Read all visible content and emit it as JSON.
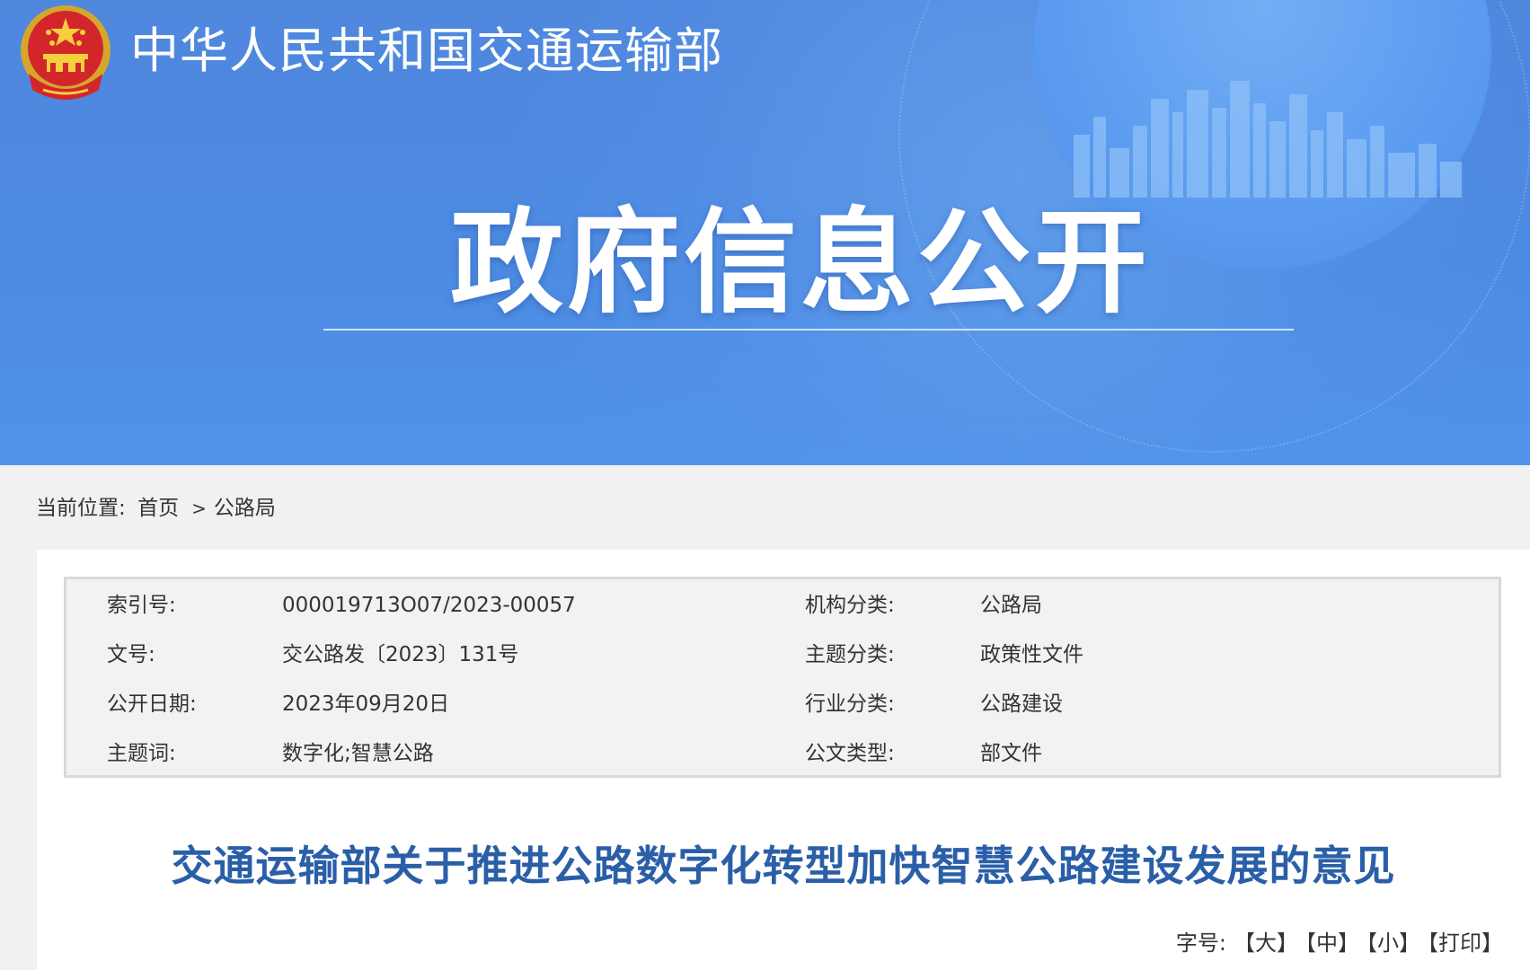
{
  "header": {
    "ministry_name": "中华人民共和国交通运输部",
    "section_title": "政府信息公开",
    "emblem_icon": "national-emblem-icon"
  },
  "breadcrumb": {
    "label": "当前位置:",
    "items": [
      "首页",
      "公路局"
    ],
    "separator": ">"
  },
  "meta": {
    "rows": [
      {
        "label1": "索引号:",
        "value1": "000019713O07/2023-00057",
        "label2": "机构分类:",
        "value2": "公路局"
      },
      {
        "label1": "文号:",
        "value1": "交公路发〔2023〕131号",
        "label2": "主题分类:",
        "value2": "政策性文件"
      },
      {
        "label1": "公开日期:",
        "value1": "2023年09月20日",
        "label2": "行业分类:",
        "value2": "公路建设"
      },
      {
        "label1": "主题词:",
        "value1": "数字化;智慧公路",
        "label2": "公文类型:",
        "value2": "部文件"
      }
    ]
  },
  "document": {
    "title": "交通运输部关于推进公路数字化转型加快智慧公路建设发展的意见"
  },
  "font_tools": {
    "label": "字号:",
    "large": "【大】",
    "medium": "【中】",
    "small": "【小】",
    "print": "【打印】"
  },
  "colors": {
    "banner_blue": "#4f87dd",
    "title_blue": "#2a5fa8",
    "page_bg": "#f1f1f1"
  }
}
